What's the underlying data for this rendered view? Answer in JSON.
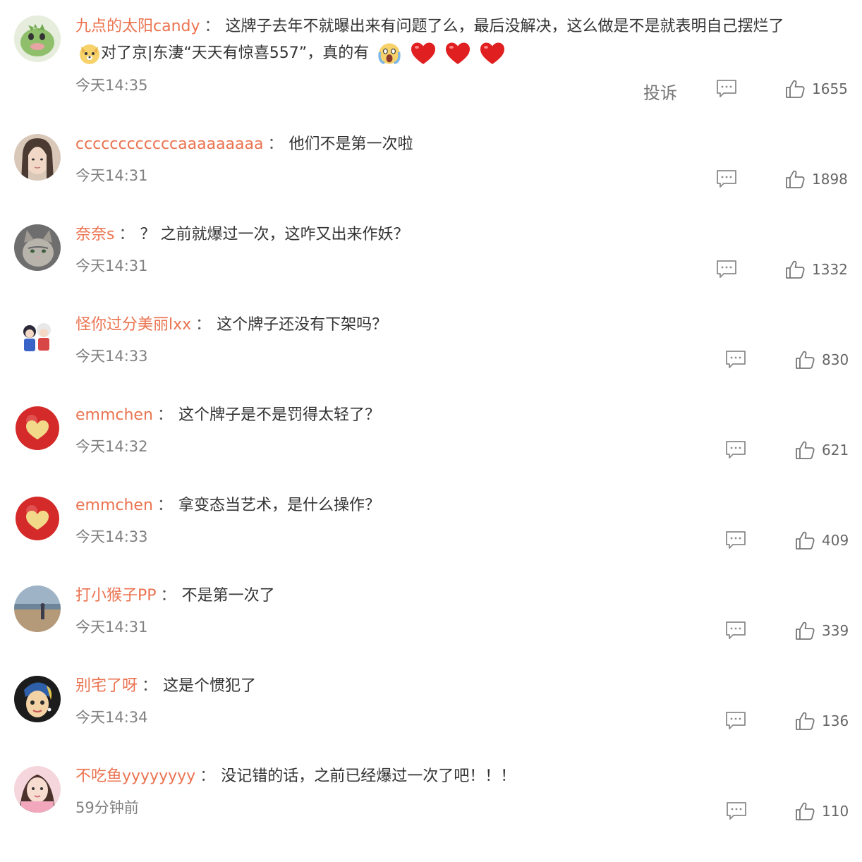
{
  "complain_label": "投诉",
  "colon": "：",
  "comments": [
    {
      "username": "九点的太阳candy",
      "text": "这牌子去年不就曝出来有问题了么，最后没解决，这么做是不是就表明自己摆烂了",
      "text2": "对了京|东淒“天天有惊喜557”，真的有",
      "time": "今天14:35",
      "likes": "1655",
      "avatar_icon": "dinosaur-avatar"
    },
    {
      "username": "ccccccccccccaaaaaaaaa",
      "text": "他们不是第一次啦",
      "time": "今天14:31",
      "likes": "1898",
      "avatar_icon": "girl-portrait-avatar"
    },
    {
      "username": "奈奈s",
      "text": "？ 之前就爆过一次，这咋又出来作妖？",
      "time": "今天14:31",
      "likes": "1332",
      "avatar_icon": "cat-avatar"
    },
    {
      "username": "怪你过分美丽lxx",
      "text": "这个牌子还没有下架吗？",
      "time": "今天14:33",
      "likes": "830",
      "avatar_icon": "cartoon-couple-avatar"
    },
    {
      "username": "emmchen",
      "text": "这个牌子是不是罚得太轻了？",
      "time": "今天14:32",
      "likes": "621",
      "avatar_icon": "apple-heart-avatar"
    },
    {
      "username": "emmchen",
      "text": "拿变态当艺术，是什么操作？",
      "time": "今天14:33",
      "likes": "409",
      "avatar_icon": "apple-heart-avatar"
    },
    {
      "username": "打小猴子PP",
      "text": "不是第一次了",
      "time": "今天14:31",
      "likes": "339",
      "avatar_icon": "beach-avatar"
    },
    {
      "username": "别宅了呀",
      "text": "这是个惯犯了",
      "time": "今天14:34",
      "likes": "136",
      "avatar_icon": "pearl-earring-avatar"
    },
    {
      "username": "不吃鱼yyyyyyyy",
      "text": "没记错的话，之前已经爆过一次了吧！！！",
      "time": "59分钟前",
      "likes": "110",
      "avatar_icon": "pink-girl-avatar"
    }
  ]
}
